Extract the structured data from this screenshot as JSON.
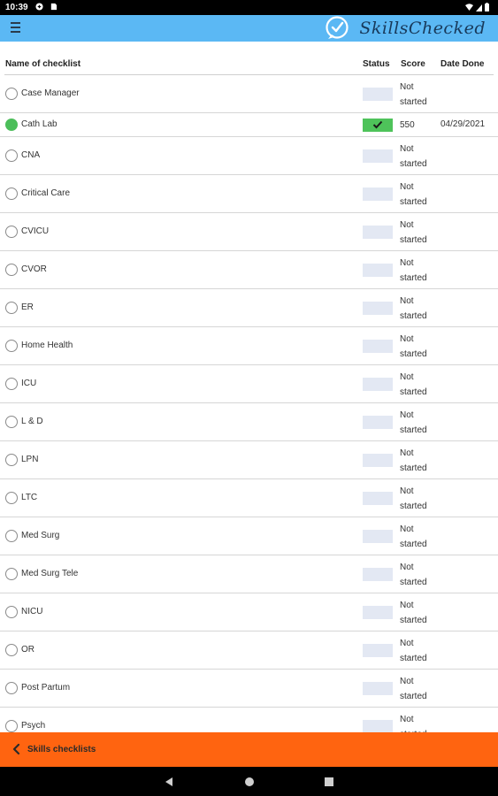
{
  "status_bar": {
    "time": "10:39",
    "icons_left": [
      "notification-icon",
      "sd-card-icon"
    ],
    "icons_right": [
      "wifi-icon",
      "signal-icon",
      "battery-icon"
    ]
  },
  "app_bar": {
    "logo_text": "SkillsChecked",
    "menu_icon": "hamburger-menu-icon",
    "color": "#5bb8f4"
  },
  "table": {
    "headers": {
      "name": "Name of checklist",
      "status": "Status",
      "score": "Score",
      "date": "Date Done"
    },
    "rows": [
      {
        "name": "Case Manager",
        "done": false,
        "score": "Not started",
        "date": ""
      },
      {
        "name": "Cath Lab",
        "done": true,
        "score": "550",
        "date": "04/29/2021"
      },
      {
        "name": "CNA",
        "done": false,
        "score": "Not started",
        "date": ""
      },
      {
        "name": "Critical Care",
        "done": false,
        "score": "Not started",
        "date": ""
      },
      {
        "name": "CVICU",
        "done": false,
        "score": "Not started",
        "date": ""
      },
      {
        "name": "CVOR",
        "done": false,
        "score": "Not started",
        "date": ""
      },
      {
        "name": "ER",
        "done": false,
        "score": "Not started",
        "date": ""
      },
      {
        "name": "Home Health",
        "done": false,
        "score": "Not started",
        "date": ""
      },
      {
        "name": "ICU",
        "done": false,
        "score": "Not started",
        "date": ""
      },
      {
        "name": "L & D",
        "done": false,
        "score": "Not started",
        "date": ""
      },
      {
        "name": "LPN",
        "done": false,
        "score": "Not started",
        "date": ""
      },
      {
        "name": "LTC",
        "done": false,
        "score": "Not started",
        "date": ""
      },
      {
        "name": "Med Surg",
        "done": false,
        "score": "Not started",
        "date": ""
      },
      {
        "name": "Med Surg Tele",
        "done": false,
        "score": "Not started",
        "date": ""
      },
      {
        "name": "NICU",
        "done": false,
        "score": "Not started",
        "date": ""
      },
      {
        "name": "OR",
        "done": false,
        "score": "Not started",
        "date": ""
      },
      {
        "name": "Post Partum",
        "done": false,
        "score": "Not started",
        "date": ""
      },
      {
        "name": "Psych",
        "done": false,
        "score": "Not started",
        "date": ""
      }
    ]
  },
  "bottom_bar": {
    "label": "Skills checklists",
    "icon": "chevron-left-icon",
    "color": "#ff6410"
  },
  "nav_bar": {
    "buttons": [
      "back-icon",
      "home-icon",
      "recents-icon"
    ]
  },
  "colors": {
    "done_green": "#4ec35a",
    "pending_status": "#e3e8f3"
  }
}
